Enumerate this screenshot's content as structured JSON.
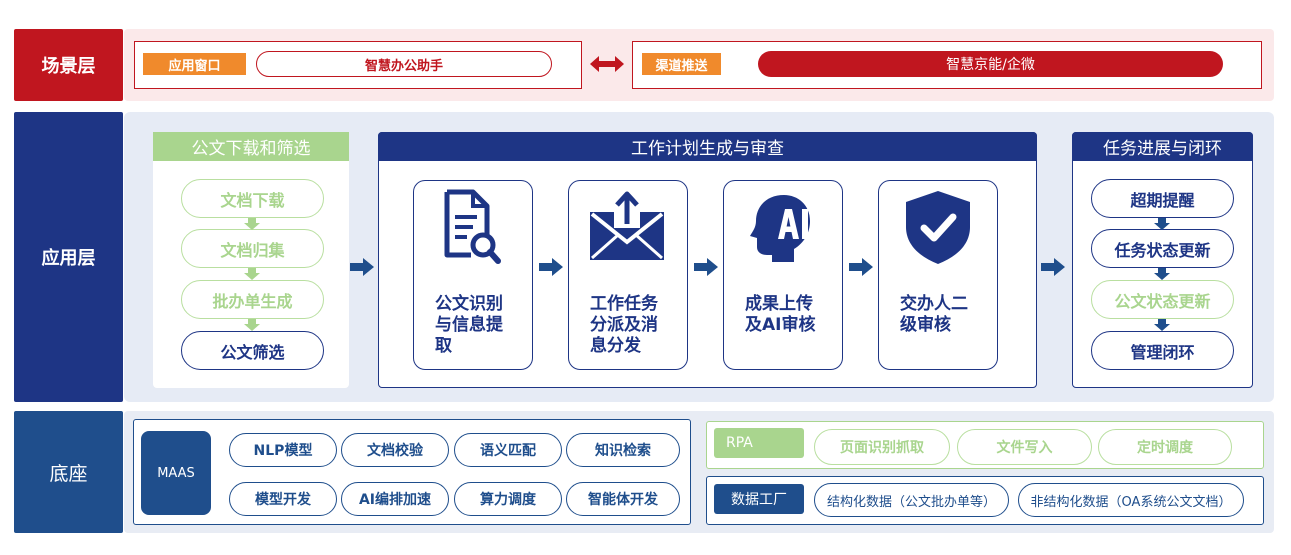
{
  "scene_layer": {
    "label": "场景层",
    "app_window_tag": "应用窗口",
    "app_window_value": "智慧办公助手",
    "channel_tag": "渠道推送",
    "channel_value": "智慧京能/企微"
  },
  "app_layer": {
    "label": "应用层",
    "download": {
      "title": "公文下载和筛选",
      "steps": [
        "文档下载",
        "文档归集",
        "批办单生成",
        "公文筛选"
      ]
    },
    "plan": {
      "title": "工作计划生成与审查",
      "cards": [
        {
          "icon": "document-search-icon",
          "lines": [
            "公文识别",
            "与信息提",
            "取"
          ]
        },
        {
          "icon": "envelope-upload-icon",
          "lines": [
            "工作任务",
            "分派及消",
            "息分发"
          ]
        },
        {
          "icon": "ai-head-icon",
          "icon_text": "AI",
          "lines": [
            "成果上传",
            "及AI审核"
          ]
        },
        {
          "icon": "shield-check-icon",
          "lines": [
            "交办人二",
            "级审核"
          ]
        }
      ]
    },
    "progress": {
      "title": "任务进展与闭环",
      "steps": [
        "超期提醒",
        "任务状态更新",
        "公文状态更新",
        "管理闭环"
      ]
    }
  },
  "base_layer": {
    "label": "底座",
    "maas": {
      "label": "MAAS",
      "capabilities": [
        "NLP模型",
        "文档校验",
        "语义匹配",
        "知识检索",
        "模型开发",
        "AI编排加速",
        "算力调度",
        "智能体开发"
      ]
    },
    "rpa": {
      "label": "RPA",
      "items": [
        "页面识别抓取",
        "文件写入",
        "定时调度"
      ]
    },
    "data_factory": {
      "label": "数据工厂",
      "items": [
        "结构化数据（公文批办单等）",
        "非结构化数据（OA系统公文文档）"
      ]
    }
  },
  "colors": {
    "red": "#c0161f",
    "navy": "#1e3585",
    "blue": "#1f4e8c",
    "green": "#a9d58e",
    "orange": "#f08a2c"
  }
}
